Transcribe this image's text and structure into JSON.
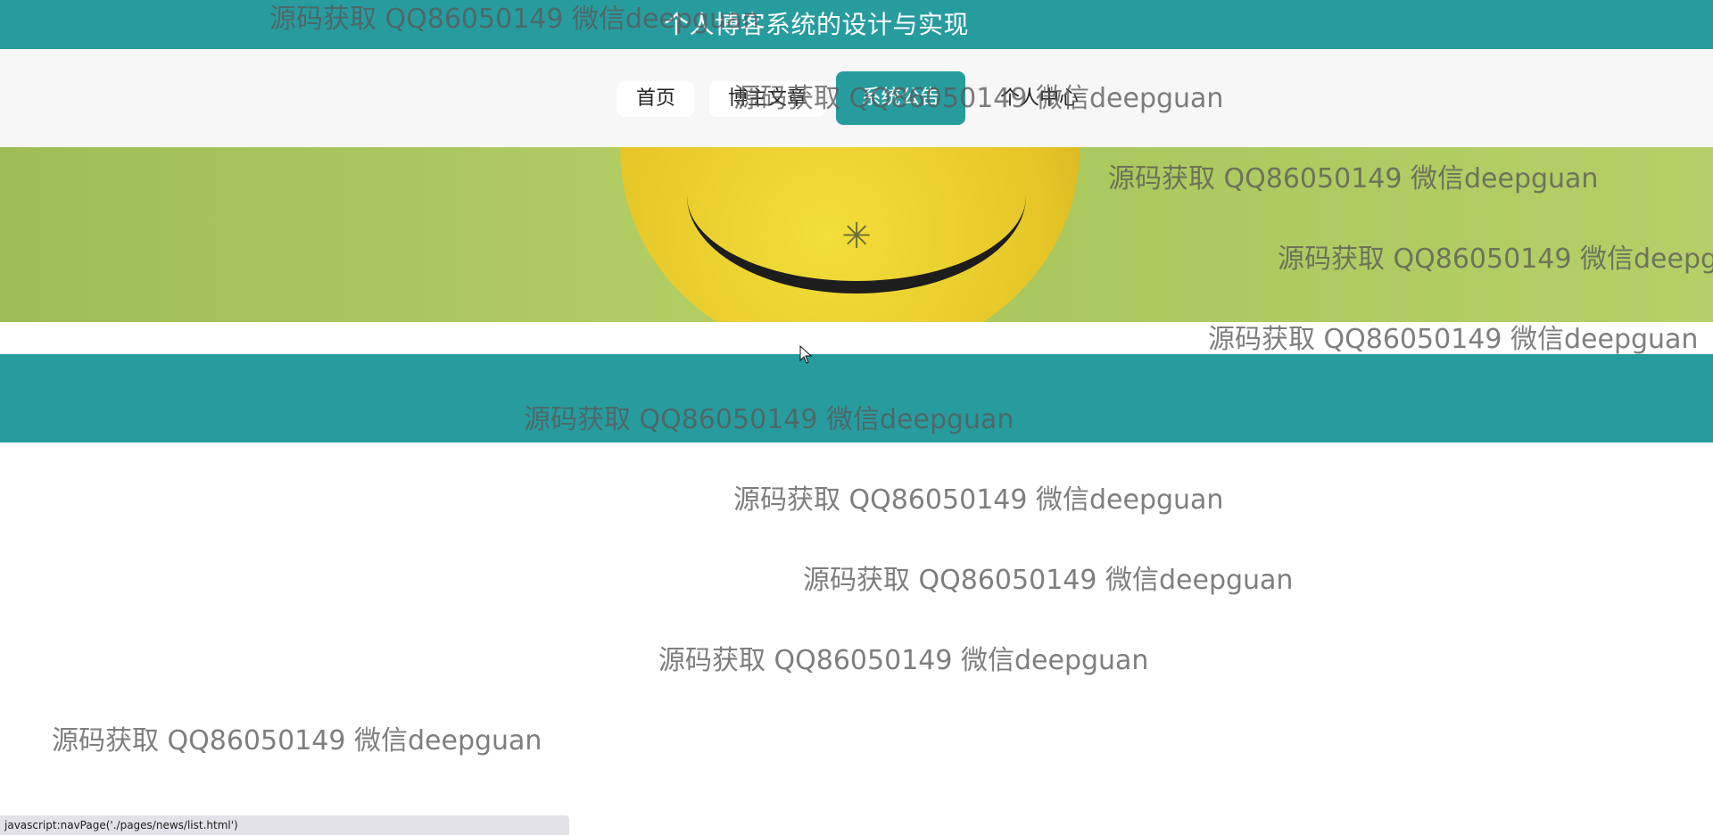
{
  "header": {
    "title": "个人博客系统的设计与实现"
  },
  "nav": {
    "items": [
      {
        "label": "首页"
      },
      {
        "label": "博主文章"
      },
      {
        "label": "系统公告"
      },
      {
        "label": "个人中心"
      }
    ]
  },
  "watermark": {
    "text": "源码获取 QQ86050149 微信deepguan"
  },
  "status_bar": {
    "url": "javascript:navPage('./pages/news/list.html')"
  },
  "colors": {
    "primary": "#279c9f",
    "nav_bg": "#f7f7f7",
    "banner_green": "#b2cd63"
  },
  "icons": [
    "loading-spinner-icon",
    "mouse-cursor-icon"
  ]
}
